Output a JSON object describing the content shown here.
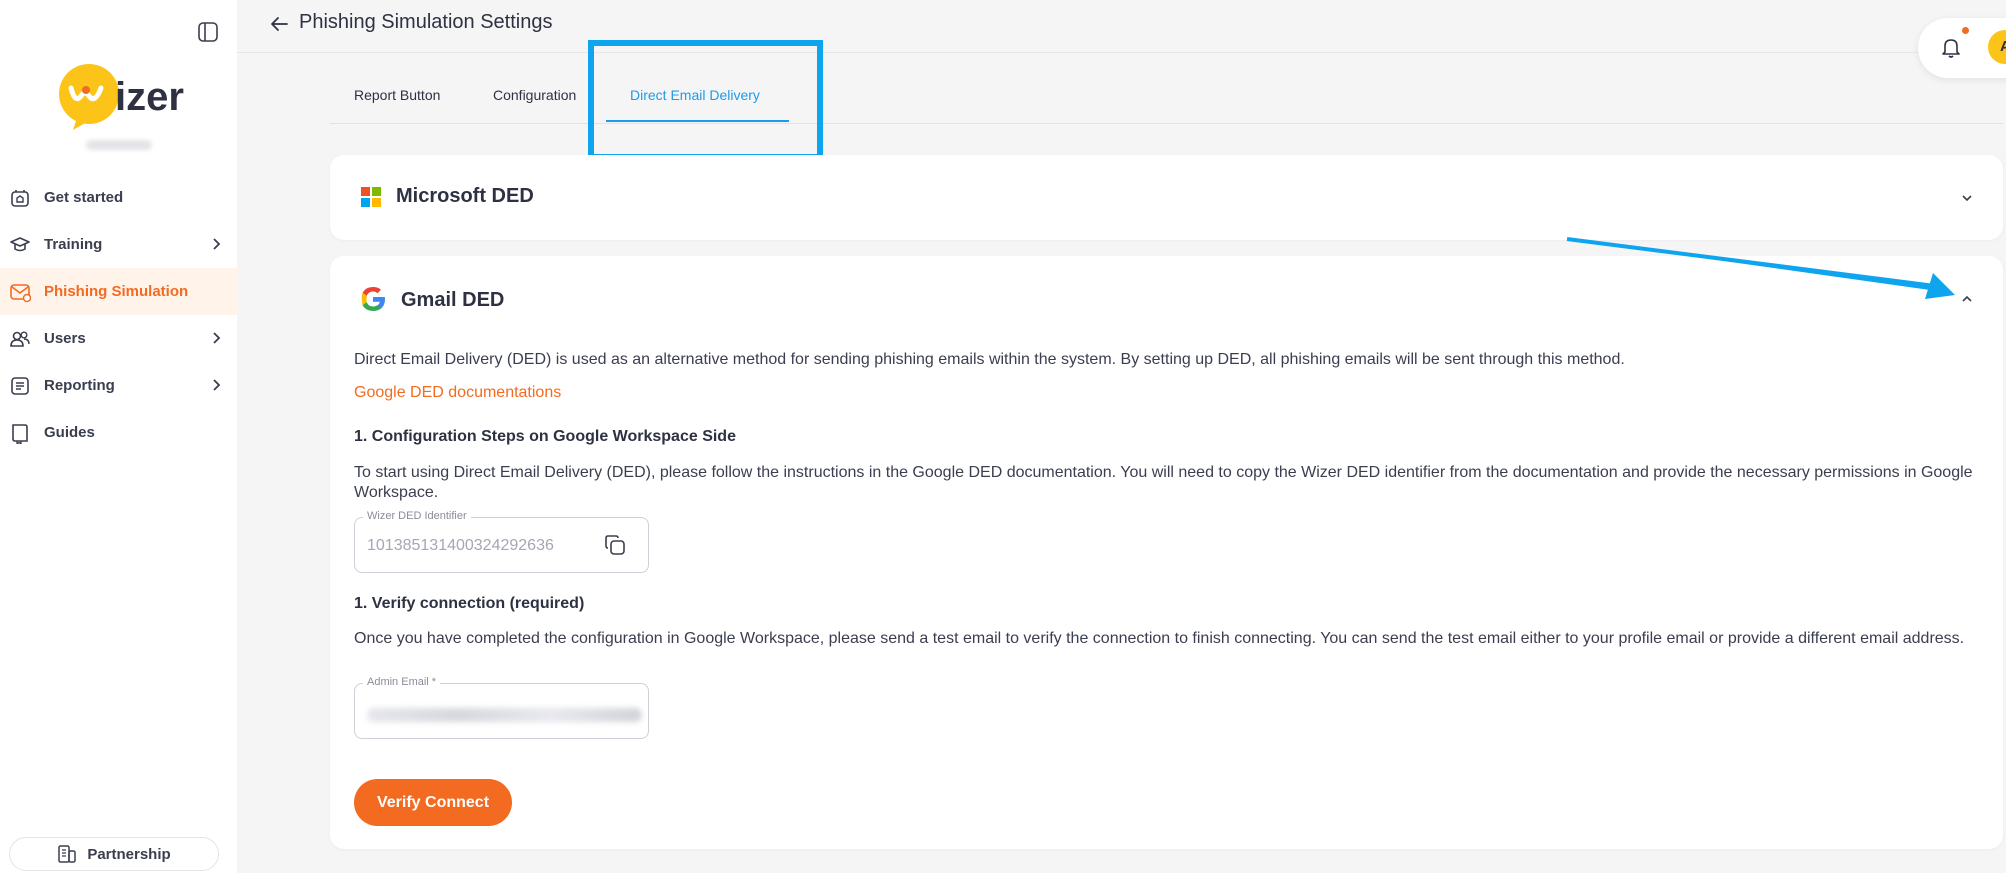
{
  "sidebar": {
    "logo_text": "wizer",
    "items": [
      {
        "label": "Get started",
        "icon": "home-icon",
        "active": false,
        "has_chevron": false
      },
      {
        "label": "Training",
        "icon": "graduation-cap-icon",
        "active": false,
        "has_chevron": true
      },
      {
        "label": "Phishing Simulation",
        "icon": "mail-icon",
        "active": true,
        "has_chevron": false
      },
      {
        "label": "Users",
        "icon": "users-icon",
        "active": false,
        "has_chevron": true
      },
      {
        "label": "Reporting",
        "icon": "report-icon",
        "active": false,
        "has_chevron": true
      },
      {
        "label": "Guides",
        "icon": "book-icon",
        "active": false,
        "has_chevron": false
      }
    ],
    "partnership_label": "Partnership"
  },
  "header": {
    "title": "Phishing Simulation Settings",
    "avatar_initial": "A"
  },
  "tabs": [
    {
      "label": "Report Button",
      "active": false
    },
    {
      "label": "Configuration",
      "active": false
    },
    {
      "label": "Direct Email Delivery",
      "active": true
    }
  ],
  "microsoft_card": {
    "title": "Microsoft DED",
    "expanded": false
  },
  "gmail_card": {
    "title": "Gmail DED",
    "expanded": true,
    "intro": "Direct Email Delivery (DED) is used as an alternative method for sending phishing emails within the system. By setting up DED, all phishing emails will be sent through this method.",
    "doc_link": "Google DED documentations",
    "step1_heading": "1. Configuration Steps on Google Workspace Side",
    "step1_text": "To start using Direct Email Delivery (DED), please follow the instructions in the Google DED documentation. You will need to copy the Wizer DED identifier from the documentation and provide the necessary permissions in Google Workspace.",
    "identifier_label": "Wizer DED Identifier",
    "identifier_value": "101385131400324292636",
    "step2_heading": "1. Verify connection (required)",
    "step2_text": "Once you have completed the configuration in Google Workspace, please send a test email to verify the connection to finish connecting. You can send the test email either to your profile email or provide a different email address.",
    "email_label": "Admin Email *",
    "verify_button": "Verify Connect"
  },
  "colors": {
    "accent": "#f26b21",
    "tab_active": "#1e9be8",
    "highlight": "#0ea5ee"
  }
}
